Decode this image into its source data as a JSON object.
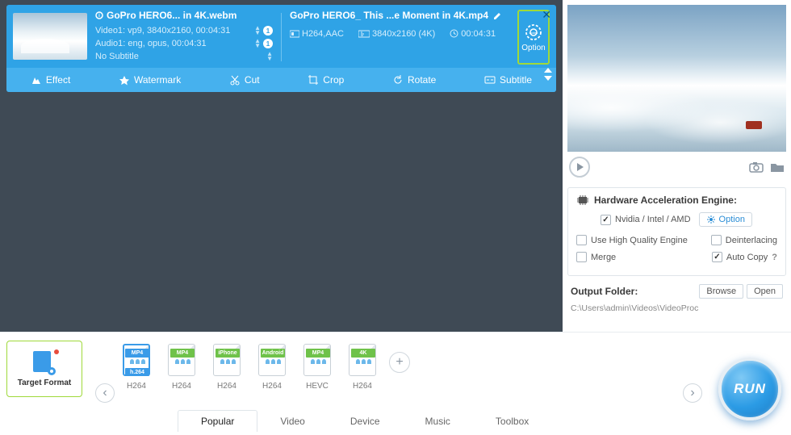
{
  "source": {
    "title": "GoPro HERO6... in 4K.webm",
    "video_line": "Video1: vp9, 3840x2160, 00:04:31",
    "audio_line": "Audio1: eng, opus, 00:04:31",
    "subtitle_line": "No Subtitle",
    "track_count": "1"
  },
  "dest": {
    "title": "GoPro HERO6_ This ...e Moment in 4K.mp4",
    "codec": "H264,AAC",
    "resolution": "3840x2160 (4K)",
    "duration": "00:04:31",
    "option_label": "Option"
  },
  "tools": {
    "effect": "Effect",
    "watermark": "Watermark",
    "cut": "Cut",
    "crop": "Crop",
    "rotate": "Rotate",
    "subtitle": "Subtitle"
  },
  "hw": {
    "title": "Hardware Acceleration Engine:",
    "chip_label": "Nvidia / Intel / AMD",
    "option_btn": "Option",
    "hq": "Use High Quality Engine",
    "deint": "Deinterlacing",
    "merge": "Merge",
    "autocopy": "Auto Copy"
  },
  "output": {
    "label": "Output Folder:",
    "path": "C:\\Users\\admin\\Videos\\VideoProc",
    "browse": "Browse",
    "open": "Open"
  },
  "target_format_label": "Target Format",
  "formats": [
    {
      "top": "MP4",
      "bottom": "h.264",
      "label": "H264",
      "selected": true
    },
    {
      "top": "MP4",
      "bottom": "",
      "label": "H264",
      "selected": false
    },
    {
      "top": "iPhone",
      "bottom": "",
      "label": "H264",
      "selected": false
    },
    {
      "top": "Android",
      "bottom": "",
      "label": "H264",
      "selected": false
    },
    {
      "top": "MP4",
      "bottom": "",
      "label": "HEVC",
      "selected": false
    },
    {
      "top": "4K",
      "bottom": "",
      "label": "H264",
      "selected": false
    }
  ],
  "tabs": [
    "Popular",
    "Video",
    "Device",
    "Music",
    "Toolbox"
  ],
  "active_tab": "Popular",
  "run_label": "RUN"
}
